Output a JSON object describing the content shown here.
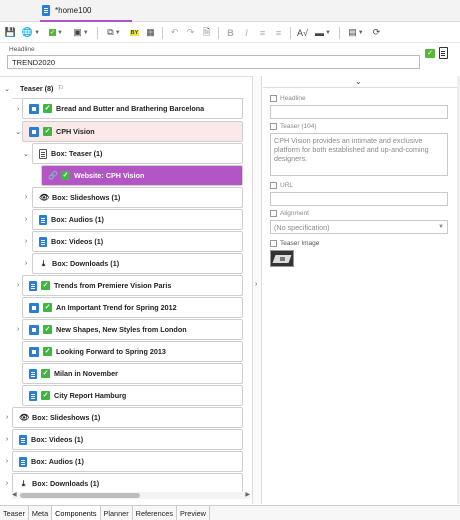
{
  "window": {
    "doc_tab_title": "*home100"
  },
  "toolbar": {
    "items": [
      "save-icon",
      "globe-icon",
      "check-dropdown-icon",
      "video-icon",
      "copy-icon",
      "by-icon",
      "sitemap-icon",
      "undo-icon",
      "redo-icon",
      "preview-icon",
      "bold-icon",
      "italic-icon",
      "bullet-list-icon",
      "numbered-list-icon",
      "spellcheck-icon",
      "align-icon",
      "style-icon",
      "refresh-icon"
    ]
  },
  "headline": {
    "label": "Headline",
    "value": "TREND2020"
  },
  "tree": {
    "teaser_group": {
      "label": "Teaser (8)"
    },
    "items": [
      {
        "label": "Bread and Butter and Brathering Barcelona"
      },
      {
        "label": "CPH Vision"
      },
      {
        "label": "Box: Teaser (1)"
      },
      {
        "label": "Website: CPH Vision"
      },
      {
        "label": "Box: Slideshows (1)"
      },
      {
        "label": "Box: Audios (1)"
      },
      {
        "label": "Box: Videos (1)"
      },
      {
        "label": "Box: Downloads (1)"
      },
      {
        "label": "Trends from Premiere Vision Paris"
      },
      {
        "label": "An Important Trend for Spring 2012"
      },
      {
        "label": "New Shapes, New Styles from London"
      },
      {
        "label": "Looking Forward to Spring 2013"
      },
      {
        "label": "Milan in November"
      },
      {
        "label": "City Report Hamburg"
      },
      {
        "label": "Box: Slideshows (1)"
      },
      {
        "label": "Box: Videos (1)"
      },
      {
        "label": "Box: Audios (1)"
      },
      {
        "label": "Box: Downloads (1)"
      }
    ]
  },
  "properties": {
    "headline_label": "Headline",
    "teaser_label": "Teaser (104)",
    "teaser_text": "CPH Vision provides an intimate and exclusive platform for both established and up-and-coming designers.",
    "url_label": "URL",
    "alignment_label": "Alignment",
    "alignment_value": "(No specification)",
    "teaser_image_label": "Teaser Image"
  },
  "bottom_tabs": [
    "Teaser",
    "Meta",
    "Components",
    "Planner",
    "References",
    "Preview"
  ],
  "colors": {
    "accent": "#b455c6",
    "check": "#3fb63f",
    "selected_row": "#fbe9ea",
    "doc_blue": "#2a7fd4"
  }
}
